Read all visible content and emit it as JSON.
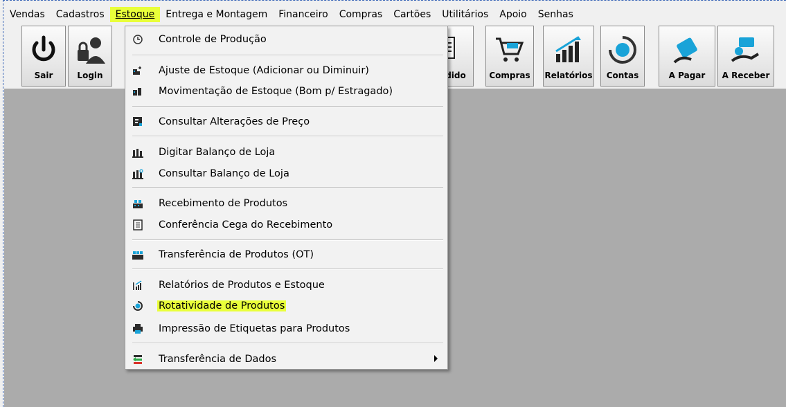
{
  "menubar": {
    "items": [
      "Vendas",
      "Cadastros",
      "Estoque",
      "Entrega e Montagem",
      "Financeiro",
      "Compras",
      "Cartões",
      "Utilitários",
      "Apoio",
      "Senhas"
    ],
    "active_index": 2
  },
  "toolbar": {
    "buttons": [
      "Sair",
      "Login",
      "Pedido",
      "Compras",
      "Relatórios",
      "Contas",
      "A Pagar",
      "A Receber"
    ],
    "partial_pedido_label": "dido"
  },
  "dropdown": {
    "items": [
      {
        "label": "Controle de Produção",
        "icon": "clock-icon"
      },
      {
        "label": "Ajuste de Estoque  (Adicionar ou Diminuir)",
        "icon": "stock-adjust-icon"
      },
      {
        "label": "Movimentação de Estoque (Bom p/ Estragado)",
        "icon": "stock-move-icon"
      },
      {
        "label": "Consultar Alterações de Preço",
        "icon": "price-icon"
      },
      {
        "label": "Digitar Balanço de Loja",
        "icon": "balance-icon"
      },
      {
        "label": "Consultar Balanço de Loja",
        "icon": "balance-search-icon"
      },
      {
        "label": "Recebimento de Produtos",
        "icon": "receive-icon"
      },
      {
        "label": "Conferência Cega do Recebimento",
        "icon": "checklist-icon"
      },
      {
        "label": "Transferência de Produtos (OT)",
        "icon": "transfer-icon"
      },
      {
        "label": "Relatórios de Produtos e Estoque",
        "icon": "report-icon"
      },
      {
        "label": "Rotatividade de Produtos",
        "icon": "rotation-icon"
      },
      {
        "label": "Impressão de Etiquetas para Produtos",
        "icon": "printer-icon"
      },
      {
        "label": "Transferência de Dados",
        "icon": "data-transfer-icon"
      }
    ]
  },
  "colors": {
    "highlight": "#e9ff3a",
    "workspace": "#ababab"
  }
}
